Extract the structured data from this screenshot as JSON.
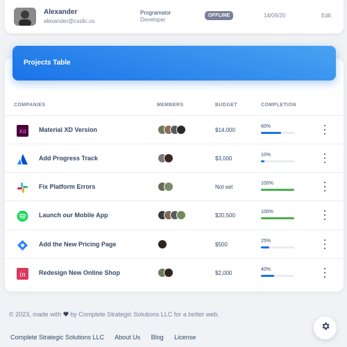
{
  "top_row": {
    "name": "Alexander",
    "email": "alexander@cssllc.co",
    "function": "Programator",
    "department": "Developer",
    "status": "OFFLINE",
    "date": "14/09/20",
    "edit_label": "Edit"
  },
  "projects": {
    "title": "Projects Table",
    "columns": [
      "COMPANIES",
      "MEMBERS",
      "BUDGET",
      "COMPLETION"
    ],
    "rows": [
      {
        "name": "Material XD Version",
        "logo": "adobe-xd-logo",
        "members": 4,
        "budget": "$14,000",
        "completion": "60%",
        "progress": 0.6,
        "color": "#1a73e8"
      },
      {
        "name": "Add Progress Track",
        "logo": "atlassian-logo",
        "members": 2,
        "budget": "$3,000",
        "completion": "10%",
        "progress": 0.1,
        "color": "#1a73e8"
      },
      {
        "name": "Fix Platform Errors",
        "logo": "slack-logo",
        "members": 2,
        "budget": "Not set",
        "completion": "100%",
        "progress": 1.0,
        "color": "#4caf50"
      },
      {
        "name": "Launch our Mobile App",
        "logo": "spotify-logo",
        "members": 4,
        "budget": "$20,500",
        "completion": "100%",
        "progress": 1.0,
        "color": "#4caf50"
      },
      {
        "name": "Add the New Pricing Page",
        "logo": "jira-logo",
        "members": 1,
        "budget": "$500",
        "completion": "25%",
        "progress": 0.25,
        "color": "#1a73e8"
      },
      {
        "name": "Redesign New Online Shop",
        "logo": "invision-logo",
        "members": 2,
        "budget": "$2,000",
        "completion": "40%",
        "progress": 0.4,
        "color": "#1a73e8"
      }
    ]
  },
  "footer": {
    "copyright_prefix": "© 2023, made with",
    "copyright_suffix": "by Complete Strategic Solutions LLC for a better web.",
    "links": [
      "Complete Strategic Solutions LLC",
      "About Us",
      "Blog",
      "License"
    ]
  },
  "fab_icon": "gear-icon"
}
